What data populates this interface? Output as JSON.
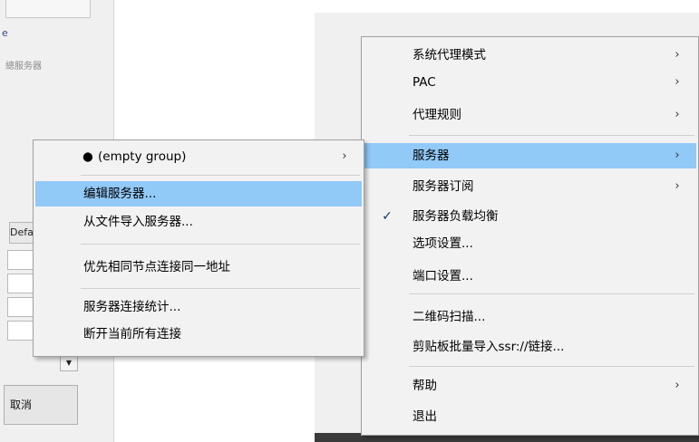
{
  "left_window": {
    "label1": "e",
    "label2": "總服务器",
    "default_button": "Defa",
    "combo_arrow_icon": "dropdown-arrow-icon",
    "cancel_button": "取消"
  },
  "main_menu": {
    "items": [
      {
        "label": "系统代理模式",
        "arrow": "›",
        "checked": false
      },
      {
        "label": "PAC",
        "arrow": "›",
        "checked": false
      },
      {
        "label": "代理规则",
        "arrow": "›",
        "checked": false
      },
      {
        "label": "服务器",
        "arrow": "›",
        "checked": false,
        "highlighted": true
      },
      {
        "label": "服务器订阅",
        "arrow": "›",
        "checked": false
      },
      {
        "label": "服务器负载均衡",
        "arrow": "",
        "checked": true,
        "check_mark": "✓"
      },
      {
        "label": "选项设置...",
        "arrow": "",
        "checked": false
      },
      {
        "label": "端口设置...",
        "arrow": "",
        "checked": false
      },
      {
        "label": "二维码扫描...",
        "arrow": "",
        "checked": false
      },
      {
        "label": "剪贴板批量导入ssr://链接...",
        "arrow": "",
        "checked": false
      },
      {
        "label": "帮助",
        "arrow": "›",
        "checked": false
      },
      {
        "label": "退出",
        "arrow": "",
        "checked": false
      }
    ]
  },
  "servers_submenu": {
    "items": [
      {
        "label": "(empty group)",
        "bullet": "●",
        "arrow": "›"
      },
      {
        "label": "编辑服务器...",
        "highlighted": true
      },
      {
        "label": "从文件导入服务器..."
      },
      {
        "label": "优先相同节点连接同一地址"
      },
      {
        "label": "服务器连接统计..."
      },
      {
        "label": "断开当前所有连接"
      }
    ]
  },
  "colors": {
    "highlight": "#91c9f7",
    "menu_background": "#f2f2f2",
    "check_mark": "#0c3a66"
  }
}
